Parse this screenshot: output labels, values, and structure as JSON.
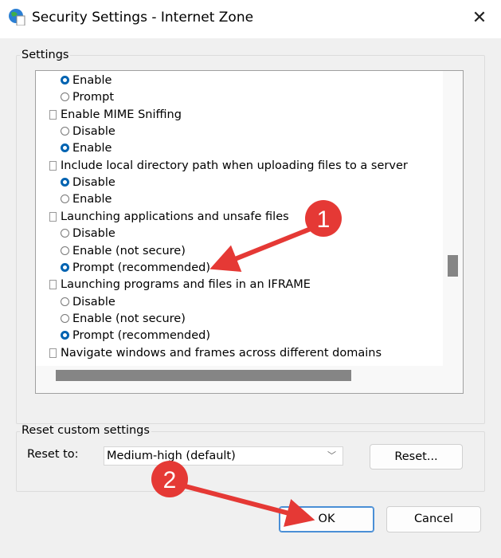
{
  "window": {
    "title": "Security Settings - Internet Zone",
    "close_icon": "close-icon",
    "app_icon": "globe-document-icon"
  },
  "settings": {
    "label": "Settings",
    "items": [
      {
        "type": "radio",
        "label": "Enable",
        "selected": true
      },
      {
        "type": "radio",
        "label": "Prompt",
        "selected": false
      },
      {
        "type": "category",
        "label": "Enable MIME Sniffing"
      },
      {
        "type": "radio",
        "label": "Disable",
        "selected": false
      },
      {
        "type": "radio",
        "label": "Enable",
        "selected": true
      },
      {
        "type": "category",
        "label": "Include local directory path when uploading files to a server"
      },
      {
        "type": "radio",
        "label": "Disable",
        "selected": true
      },
      {
        "type": "radio",
        "label": "Enable",
        "selected": false
      },
      {
        "type": "category",
        "label": "Launching applications and unsafe files"
      },
      {
        "type": "radio",
        "label": "Disable",
        "selected": false
      },
      {
        "type": "radio",
        "label": "Enable (not secure)",
        "selected": false
      },
      {
        "type": "radio",
        "label": "Prompt (recommended)",
        "selected": true
      },
      {
        "type": "category",
        "label": "Launching programs and files in an IFRAME"
      },
      {
        "type": "radio",
        "label": "Disable",
        "selected": false
      },
      {
        "type": "radio",
        "label": "Enable (not secure)",
        "selected": false
      },
      {
        "type": "radio",
        "label": "Prompt (recommended)",
        "selected": true
      },
      {
        "type": "category",
        "label": "Navigate windows and frames across different domains"
      }
    ]
  },
  "reset": {
    "group_label": "Reset custom settings",
    "reset_to_label": "Reset to:",
    "selected": "Medium-high (default)",
    "reset_button": "Reset..."
  },
  "buttons": {
    "ok": "OK",
    "cancel": "Cancel"
  },
  "annotations": {
    "step1": "1",
    "step2": "2",
    "color": "#e53935"
  }
}
